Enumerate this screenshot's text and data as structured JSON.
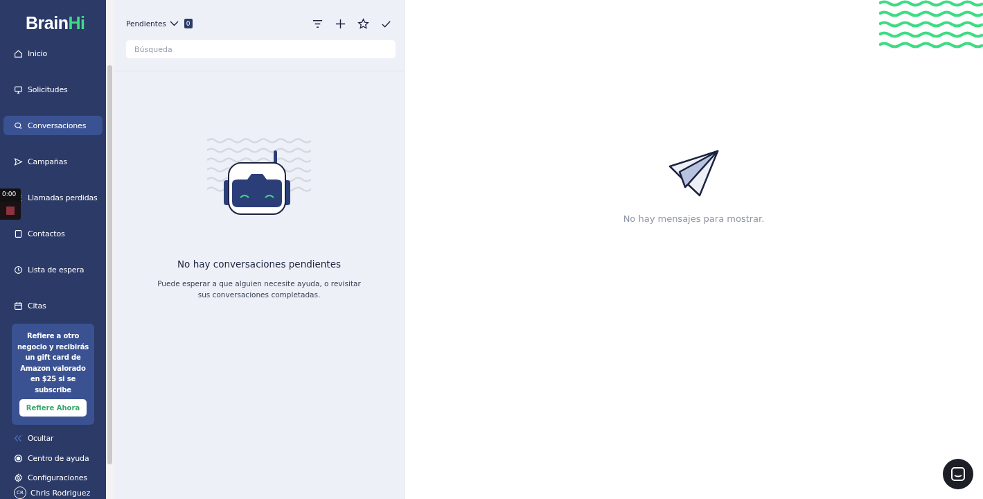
{
  "logo": {
    "primary": "Brain",
    "accent": "Hi"
  },
  "nav": [
    {
      "label": "Inicio",
      "selected": false
    },
    {
      "label": "Solicitudes",
      "selected": false
    },
    {
      "label": "Conversaciones",
      "selected": true
    },
    {
      "label": "Campañas",
      "selected": false
    },
    {
      "label": "Llamadas perdidas",
      "selected": false
    },
    {
      "label": "Contactos",
      "selected": false
    },
    {
      "label": "Lista de espera",
      "selected": false
    },
    {
      "label": "Citas",
      "selected": false
    }
  ],
  "promo": {
    "text": "Refiere a otro negocio y recibirás un gift card de Amazon valorado en $25 si se subscribe",
    "button": "Refiere Ahora"
  },
  "hide_label": "Ocultar",
  "footer_nav": [
    {
      "label": "Centro de ayuda"
    },
    {
      "label": "Configuraciones"
    }
  ],
  "user": {
    "initials": "CR",
    "name": "Chris Rodriguez"
  },
  "recorder": {
    "time": "0:00"
  },
  "list": {
    "filter": "Pendientes",
    "count": "0",
    "search_placeholder": "Búsqueda",
    "empty_title": "No hay conversaciones pendientes",
    "empty_text": "Puede esperar a que alguien necesite ayuda, o revisitar sus conversaciones completadas."
  },
  "detail": {
    "empty_text": "No hay mensajes para mostrar."
  }
}
